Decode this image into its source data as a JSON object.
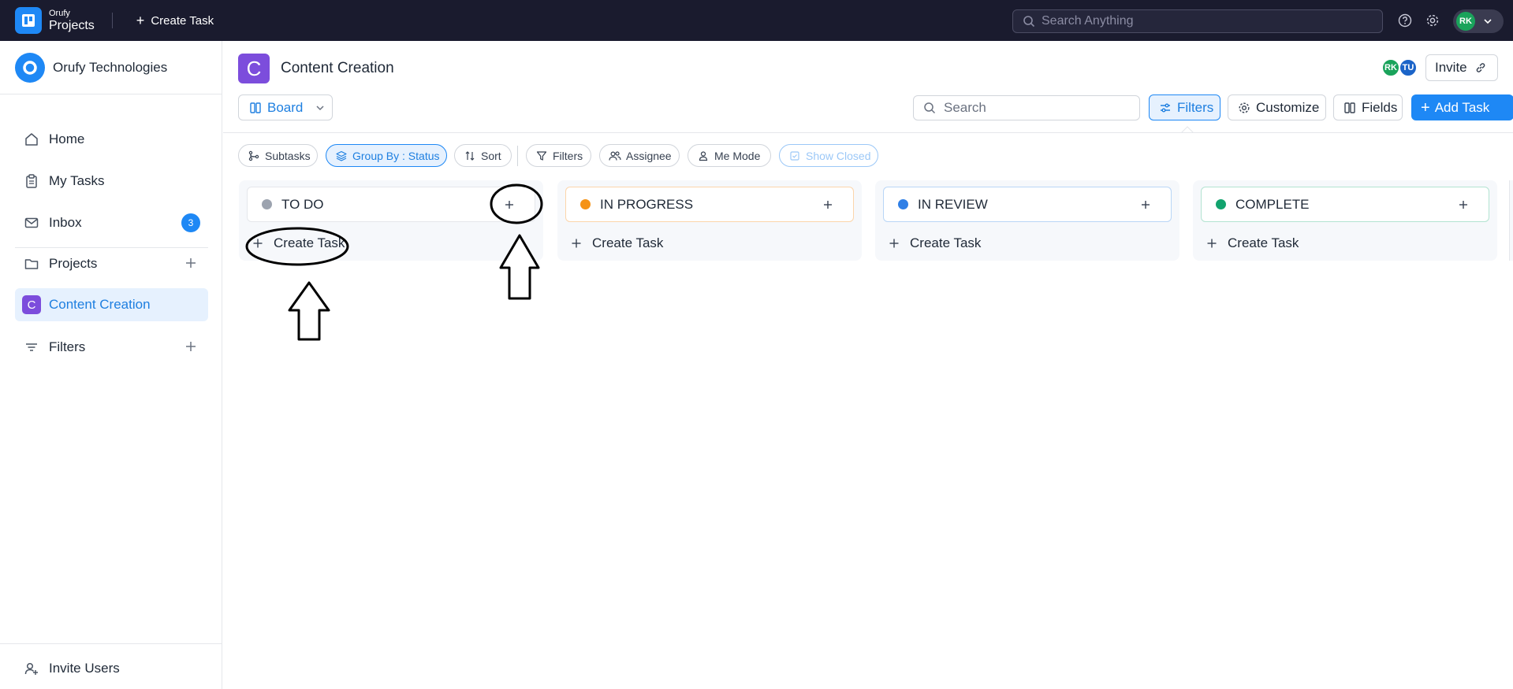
{
  "topbar": {
    "brand_top": "Orufy",
    "brand_bottom": "Projects",
    "create_task_label": "Create Task",
    "search_placeholder": "Search Anything",
    "user_initials": "RK"
  },
  "sidebar": {
    "org_name": "Orufy Technologies",
    "org_logo_letter": "O",
    "items": [
      {
        "label": "Home"
      },
      {
        "label": "My Tasks"
      },
      {
        "label": "Inbox",
        "badge": "3"
      },
      {
        "label": "Projects"
      },
      {
        "label": "Content Creation",
        "letter": "C"
      },
      {
        "label": "Filters"
      }
    ],
    "invite_label": "Invite Users"
  },
  "header": {
    "project_letter": "C",
    "project_title": "Content Creation",
    "avatars": [
      "RK",
      "TU"
    ],
    "invite_label": "Invite"
  },
  "toolbar": {
    "view_label": "Board",
    "search_placeholder": "Search",
    "filters_label": "Filters",
    "customize_label": "Customize",
    "fields_label": "Fields",
    "add_task_label": "Add Task"
  },
  "chips": {
    "subtasks": "Subtasks",
    "group_by": "Group By : Status",
    "sort": "Sort",
    "filters": "Filters",
    "assignee": "Assignee",
    "me_mode": "Me Mode",
    "show_closed": "Show Closed"
  },
  "columns": [
    {
      "title": "TO DO",
      "color": "#9ca3af",
      "create_label": "Create Task"
    },
    {
      "title": "IN PROGRESS",
      "color": "#f59316",
      "border": "#fbd5ab",
      "create_label": "Create Task"
    },
    {
      "title": "IN REVIEW",
      "color": "#2f7fe6",
      "border": "#b9d6f6",
      "create_label": "Create Task"
    },
    {
      "title": "COMPLETE",
      "color": "#12a36e",
      "border": "#b3e3d1",
      "create_label": "Create Task"
    }
  ],
  "colors": {
    "topbar_bg": "#1a1b2e",
    "accent": "#1e88f5",
    "project_purple": "#7c4ddc"
  }
}
